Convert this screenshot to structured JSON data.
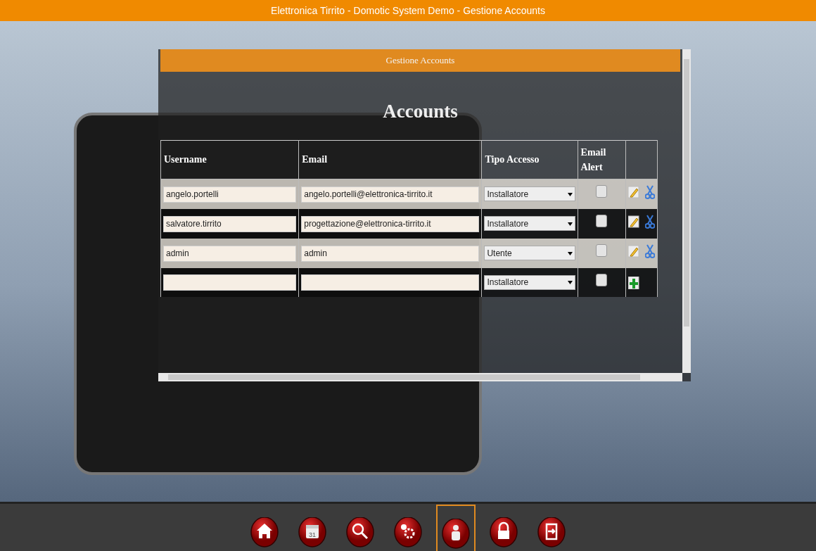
{
  "window": {
    "title": "Elettronica Tirrito - Domotic System Demo - Gestione Accounts"
  },
  "panel": {
    "title": "Gestione Accounts",
    "heading": "Accounts"
  },
  "table": {
    "columns": [
      "Username",
      "Email",
      "Tipo Accesso",
      "Email Alert"
    ],
    "rows": [
      {
        "kind": "existing",
        "username": "angelo.portelli",
        "email": "angelo.portelli@elettronica-tirrito.it",
        "access": "Installatore",
        "email_alert": false
      },
      {
        "kind": "existing",
        "username": "salvatore.tirrito",
        "email": "progettazione@elettronica-tirrito.it",
        "access": "Installatore",
        "email_alert": false
      },
      {
        "kind": "existing",
        "username": "admin",
        "email": "admin",
        "access": "Utente",
        "email_alert": false
      },
      {
        "kind": "new",
        "access": "Installatore",
        "email_alert": false
      }
    ]
  },
  "toolbar": [
    {
      "kind": "home",
      "selected": false
    },
    {
      "kind": "calendar",
      "selected": false,
      "label": "31"
    },
    {
      "kind": "search",
      "selected": false
    },
    {
      "kind": "settings",
      "selected": false
    },
    {
      "kind": "users",
      "selected": true
    },
    {
      "kind": "lock",
      "selected": false
    },
    {
      "kind": "logout",
      "selected": false
    }
  ]
}
